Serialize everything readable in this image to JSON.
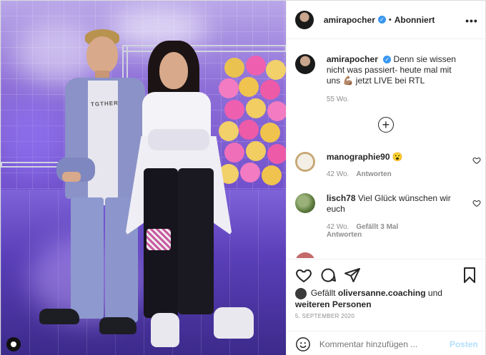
{
  "header": {
    "username": "amirapocher",
    "separator": "•",
    "follow_status": "Abonniert",
    "more_label": "•••"
  },
  "caption": {
    "username": "amirapocher",
    "text": "Denn sie wissen nicht was passiert- heute mal mit uns 💪🏽 jetzt LIVE bei RTL",
    "age": "55 Wo."
  },
  "load_more_label": "+",
  "comments": [
    {
      "username": "manographie90",
      "text": "😮",
      "age": "42 Wo.",
      "reply_label": "Antworten"
    },
    {
      "username": "lisch78",
      "text": "Viel Glück wünschen wir euch",
      "age": "42 Wo.",
      "likes_label": "Gefällt 3 Mal",
      "reply_label": "Antworten"
    }
  ],
  "likes": {
    "prefix": "Gefällt",
    "user": "oliversanne.coaching",
    "connector": "und",
    "others": "weiteren Personen"
  },
  "date": "5. SEPTEMBER 2020",
  "comment_input": {
    "placeholder": "Kommentar hinzufügen ...",
    "post_label": "Posten"
  },
  "icons": {
    "like": "heart-outline-icon",
    "comment": "speech-bubble-icon",
    "share": "paper-plane-icon",
    "save": "bookmark-icon",
    "emoji": "smiley-icon",
    "more": "three-dots-icon"
  },
  "colors": {
    "verified": "#3897f0",
    "post_button_disabled": "#b2dffc",
    "muted_text": "#8e8e8e"
  }
}
